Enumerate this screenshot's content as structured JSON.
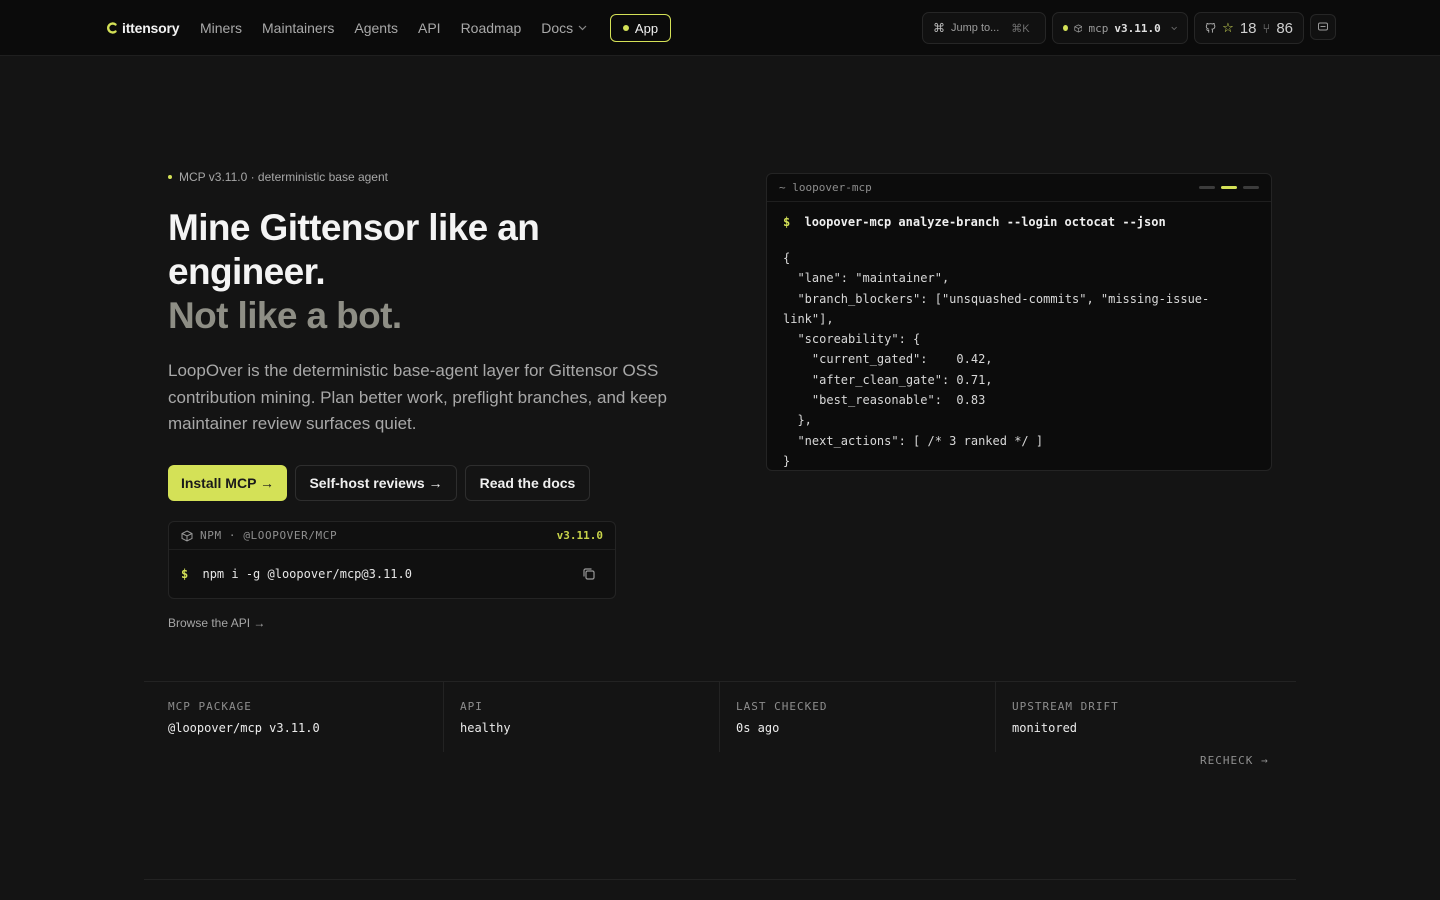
{
  "brand": {
    "name": "ittensory"
  },
  "nav": {
    "links": [
      "Miners",
      "Maintainers",
      "Agents",
      "API",
      "Roadmap"
    ],
    "docs_label": "Docs",
    "app_label": "App"
  },
  "toolbar": {
    "jump_label": "Jump to...",
    "jump_shortcut": "⌘K",
    "mcp_label": "mcp",
    "mcp_version": "v3.11.0",
    "stars": "18",
    "forks": "86"
  },
  "hero": {
    "eyebrow": "MCP v3.11.0 · deterministic base agent",
    "headline_line1": "Mine Gittensor like an engineer.",
    "headline_line2": "Not like a bot.",
    "lede": "LoopOver is the deterministic base-agent layer for Gittensor OSS contribution mining. Plan better work, preflight branches, and keep maintainer review surfaces quiet.",
    "buttons": {
      "install": "Install MCP →",
      "selfhost": "Self-host reviews →",
      "docs": "Read the docs"
    },
    "npm": {
      "label": "NPM · @LOOPOVER/MCP",
      "version": "v3.11.0",
      "prompt": "$",
      "command": "npm i -g @loopover/mcp@3.11.0"
    },
    "browse_api": "Browse the API →"
  },
  "terminal": {
    "title": "~ loopover-mcp",
    "prompt": "$",
    "command": "loopover-mcp analyze-branch --login octocat --json",
    "output": "{\n  \"lane\": \"maintainer\",\n  \"branch_blockers\": [\"unsquashed-commits\", \"missing-issue-link\"],\n  \"scoreability\": {\n    \"current_gated\":    0.42,\n    \"after_clean_gate\": 0.71,\n    \"best_reasonable\":  0.83\n  },\n  \"next_actions\": [ /* 3 ranked */ ]\n}"
  },
  "status": {
    "items": [
      {
        "label": "MCP PACKAGE",
        "value": "@loopover/mcp v3.11.0"
      },
      {
        "label": "API",
        "value": "healthy"
      },
      {
        "label": "LAST CHECKED",
        "value": "0s ago"
      },
      {
        "label": "UPSTREAM DRIFT",
        "value": "monitored"
      }
    ],
    "recheck_label": "RECHECK →"
  },
  "colors": {
    "accent": "#d4e157",
    "background": "#141414",
    "nav_background": "#0b0b0b"
  }
}
